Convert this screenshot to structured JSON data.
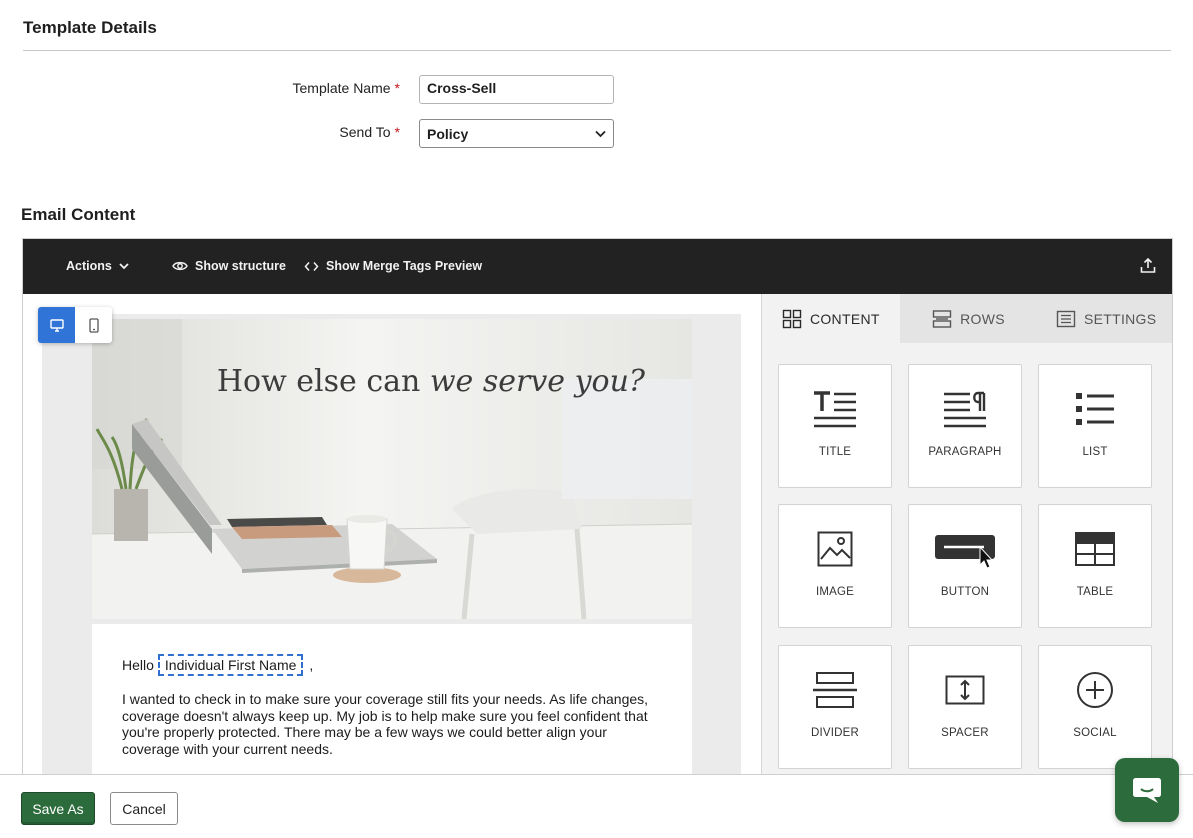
{
  "template_details": {
    "title": "Template Details",
    "name_label": "Template Name",
    "name_value": "Cross-Sell",
    "send_to_label": "Send To",
    "send_to_value": "Policy",
    "required_mark": "*"
  },
  "email_content": {
    "title": "Email Content"
  },
  "toolbar": {
    "actions_label": "Actions",
    "show_structure_label": "Show structure",
    "merge_preview_label": "Show Merge Tags Preview"
  },
  "preview": {
    "hero_title_plain": "How else can",
    "hero_title_italic": "we serve you?",
    "greeting": "Hello",
    "merge_tag": "Individual First Name",
    "greeting_suffix": ",",
    "paragraph": "I wanted to check in to make sure your coverage still fits your needs. As life changes, coverage doesn't always keep up. My job is to help make sure you feel confident that you're properly protected. There may be a few ways we could better align your coverage with your current needs."
  },
  "side_panel": {
    "tabs": [
      {
        "label": "CONTENT",
        "active": true
      },
      {
        "label": "ROWS",
        "active": false
      },
      {
        "label": "SETTINGS",
        "active": false
      }
    ],
    "blocks": [
      {
        "label": "TITLE",
        "icon": "title-icon"
      },
      {
        "label": "PARAGRAPH",
        "icon": "paragraph-icon"
      },
      {
        "label": "LIST",
        "icon": "list-icon"
      },
      {
        "label": "IMAGE",
        "icon": "image-icon"
      },
      {
        "label": "BUTTON",
        "icon": "button-icon"
      },
      {
        "label": "TABLE",
        "icon": "table-icon"
      },
      {
        "label": "DIVIDER",
        "icon": "divider-icon"
      },
      {
        "label": "SPACER",
        "icon": "spacer-icon"
      },
      {
        "label": "SOCIAL",
        "icon": "social-icon"
      }
    ]
  },
  "footer": {
    "save_as_label": "Save As",
    "cancel_label": "Cancel"
  },
  "colors": {
    "toolbar_bg": "#222222",
    "primary_green": "#2c6b3b",
    "device_active_blue": "#2f74d6",
    "required_red": "#c0161b",
    "merge_tag_border": "#2f6fcf"
  }
}
